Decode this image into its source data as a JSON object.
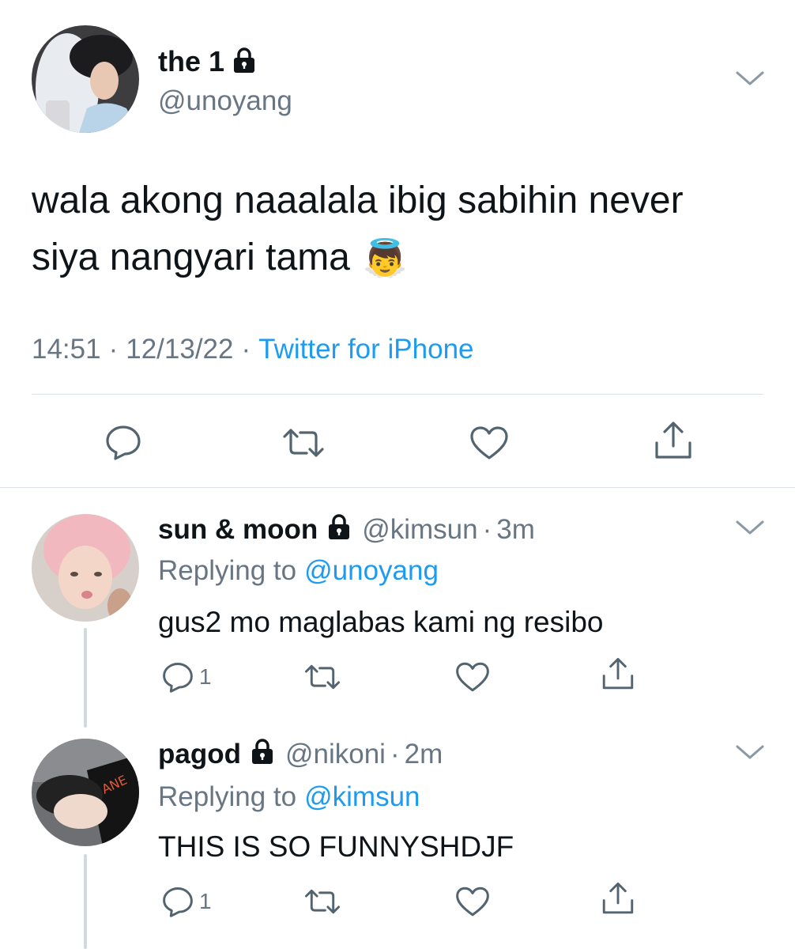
{
  "main_tweet": {
    "display_name": "the 1",
    "handle": "@unoyang",
    "text_line1": "wala akong naaalala ibig sabihin never",
    "text_line2": "siya nangyari tama",
    "emoji": "👼",
    "time": "14:51",
    "sep1": "·",
    "date": "12/13/22",
    "sep2": "·",
    "source": "Twitter for iPhone"
  },
  "replies": [
    {
      "display_name": "sun & moon",
      "handle": "@kimsun",
      "dot": "·",
      "age": "3m",
      "replying_prefix": "Replying to",
      "replying_to": "@unoyang",
      "text": "gus2 mo maglabas kami ng resibo",
      "reply_count": "1"
    },
    {
      "display_name": "pagod",
      "handle": "@nikoni",
      "dot": "·",
      "age": "2m",
      "replying_prefix": "Replying to",
      "replying_to": "@kimsun",
      "text": "THIS IS SO FUNNYSHDJF",
      "reply_count": "1"
    }
  ],
  "icons": {
    "reply": "reply-icon",
    "retweet": "retweet-icon",
    "like": "heart-icon",
    "share": "share-icon",
    "lock": "lock-icon",
    "more": "chevron-down-icon"
  },
  "colors": {
    "text": "#0f1419",
    "muted": "#687684",
    "link": "#1d9bf0",
    "divider": "#dbe1e6"
  }
}
